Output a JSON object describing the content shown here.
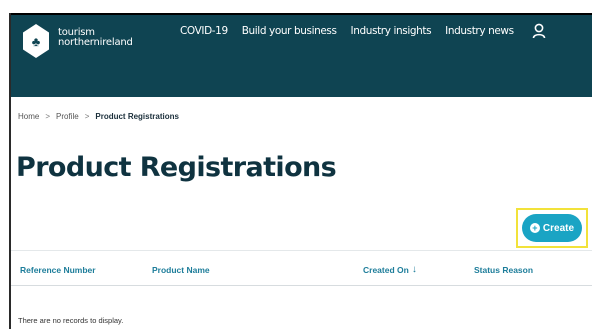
{
  "header": {
    "logo_line1": "tourism",
    "logo_line2": "northernireland",
    "nav": [
      "COVID-19",
      "Build your business",
      "Industry insights",
      "Industry news"
    ]
  },
  "breadcrumb": {
    "items": [
      "Home",
      "Profile"
    ],
    "current": "Product Registrations",
    "separator": ">"
  },
  "page": {
    "title": "Product Registrations",
    "create_label": "Create"
  },
  "table": {
    "columns": [
      "Reference Number",
      "Product Name",
      "Created On",
      "Status Reason"
    ],
    "sort_indicator": "↓",
    "empty_message": "There are no records to display."
  },
  "colors": {
    "header_bg": "#0f4452",
    "accent": "#1aa4c4",
    "highlight": "#f2e23a",
    "column_header": "#1d7d9a"
  }
}
